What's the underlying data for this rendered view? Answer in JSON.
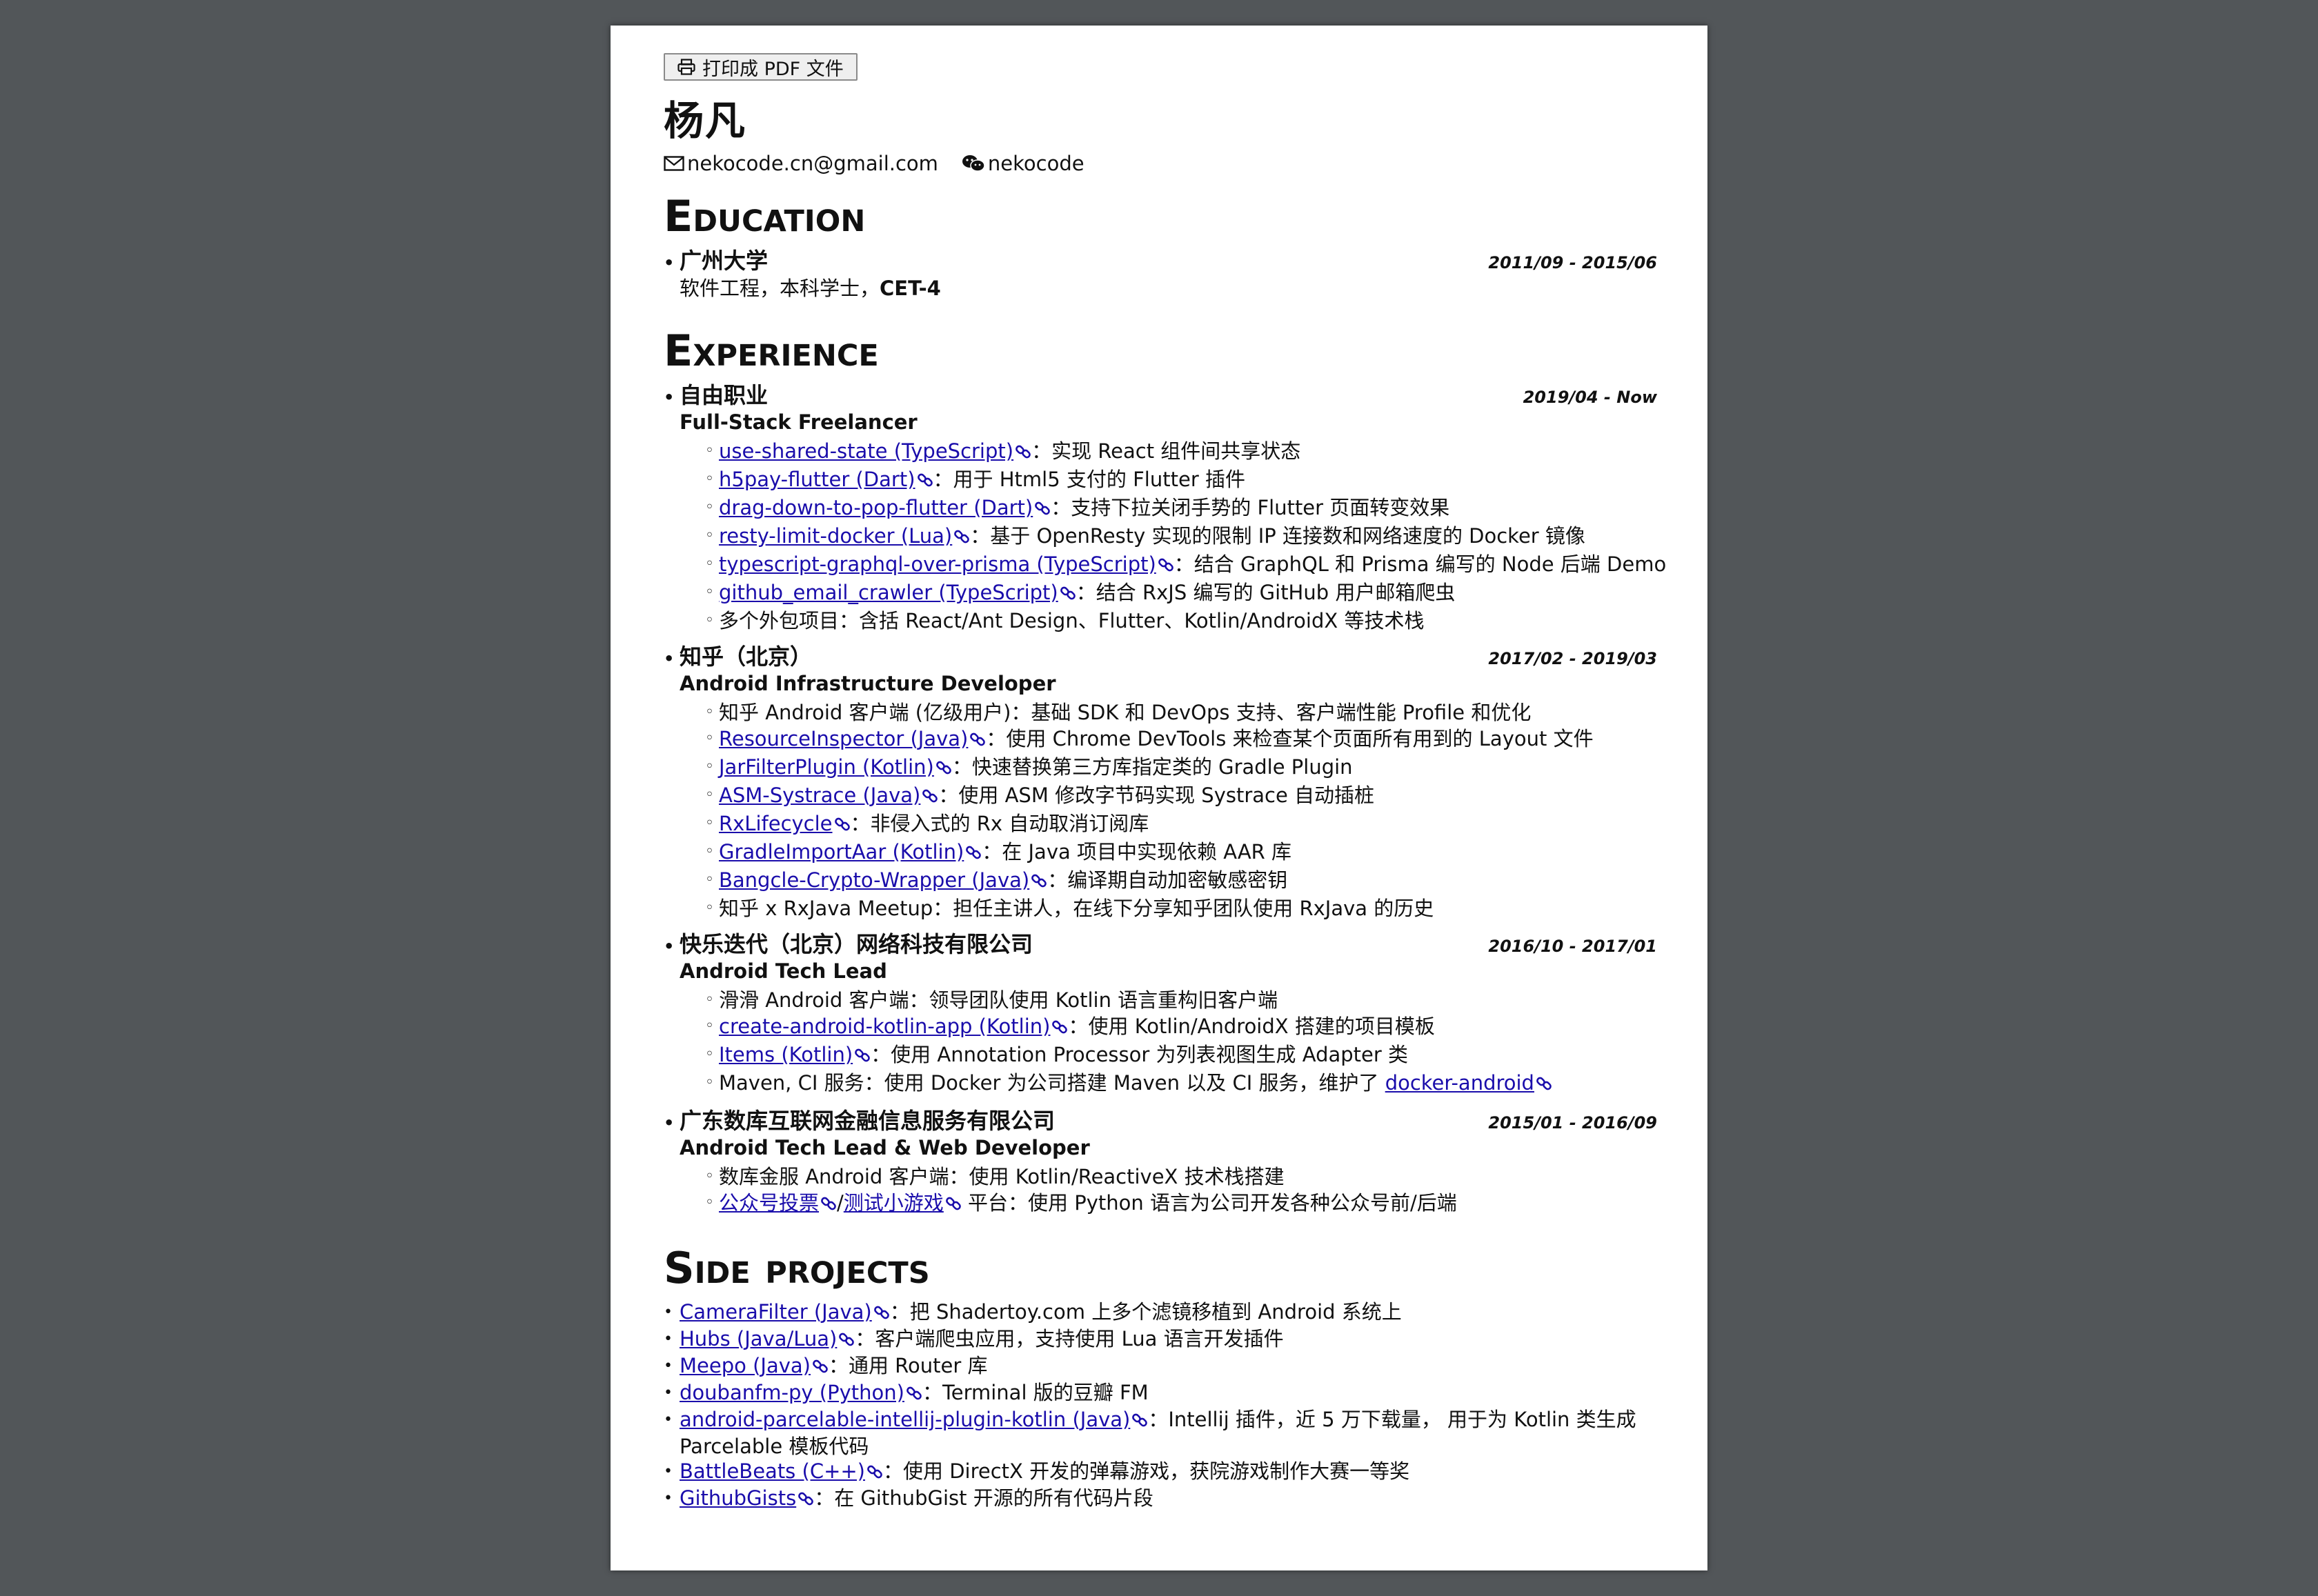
{
  "print_button": {
    "label": "打印成 PDF 文件"
  },
  "name": "杨凡",
  "contacts": {
    "email": "nekocode.cn@gmail.com",
    "wechat": "nekocode"
  },
  "sections": {
    "education": "Education",
    "experience": "Experience",
    "side_projects": "Side projects"
  },
  "education": {
    "school": "广州大学",
    "date": "2011/09 - 2015/06",
    "degree": "软件工程，本科学士，",
    "cert": "CET-4"
  },
  "experience": [
    {
      "org": "自由职业",
      "date": "2019/04 - Now",
      "role": "Full-Stack Freelancer",
      "items": [
        {
          "link": "use-shared-state (TypeScript)",
          "text": "：实现 React 组件间共享状态"
        },
        {
          "link": "h5pay-flutter (Dart)",
          "text": "：用于 Html5 支付的 Flutter 插件"
        },
        {
          "link": "drag-down-to-pop-flutter (Dart)",
          "text": "：支持下拉关闭手势的 Flutter 页面转变效果"
        },
        {
          "link": "resty-limit-docker (Lua)",
          "text": "：基于 OpenResty 实现的限制 IP 连接数和网络速度的 Docker 镜像"
        },
        {
          "link": "typescript-graphql-over-prisma (TypeScript)",
          "text": "：结合 GraphQL 和 Prisma 编写的 Node 后端 Demo"
        },
        {
          "link": "github_email_crawler (TypeScript)",
          "text": "：结合 RxJS 编写的 GitHub 用户邮箱爬虫"
        },
        {
          "link": "",
          "text": "多个外包项目：含括 React/Ant Design、Flutter、Kotlin/AndroidX 等技术栈"
        }
      ]
    },
    {
      "org": "知乎（北京）",
      "date": "2017/02 - 2019/03",
      "role": "Android Infrastructure Developer",
      "items": [
        {
          "link": "",
          "text": "知乎 Android 客户端 (亿级用户)：基础 SDK 和 DevOps 支持、客户端性能 Profile 和优化"
        },
        {
          "link": "ResourceInspector (Java)",
          "text": "：使用 Chrome DevTools 来检查某个页面所有用到的 Layout 文件"
        },
        {
          "link": "JarFilterPlugin (Kotlin)",
          "text": "：快速替换第三方库指定类的 Gradle Plugin"
        },
        {
          "link": "ASM-Systrace (Java)",
          "text": "：使用 ASM 修改字节码实现 Systrace 自动插桩"
        },
        {
          "link": "RxLifecycle",
          "text": "：非侵入式的 Rx 自动取消订阅库"
        },
        {
          "link": "GradleImportAar (Kotlin)",
          "text": "：在 Java 项目中实现依赖 AAR 库"
        },
        {
          "link": "Bangcle-Crypto-Wrapper (Java)",
          "text": "：编译期自动加密敏感密钥"
        },
        {
          "link": "",
          "text": "知乎 x RxJava Meetup：担任主讲人，在线下分享知乎团队使用 RxJava 的历史"
        }
      ]
    },
    {
      "org": "快乐迭代（北京）网络科技有限公司",
      "date": "2016/10 - 2017/01",
      "role": "Android Tech Lead",
      "items": [
        {
          "link": "",
          "text": "滑滑 Android 客户端：领导团队使用 Kotlin 语言重构旧客户端"
        },
        {
          "link": "create-android-kotlin-app (Kotlin)",
          "text": "：使用 Kotlin/AndroidX 搭建的项目模板"
        },
        {
          "link": "Items (Kotlin)",
          "text": "：使用 Annotation Processor 为列表视图生成 Adapter 类"
        },
        {
          "link": "",
          "text": "Maven, CI 服务：使用 Docker 为公司搭建 Maven 以及 CI 服务，维护了 ",
          "tail_link": "docker-android"
        }
      ]
    },
    {
      "org": "广东数库互联网金融信息服务有限公司",
      "date": "2015/01 - 2016/09",
      "role": "Android Tech Lead & Web Developer",
      "items": [
        {
          "link": "",
          "text": "数库金服 Android 客户端：使用 Kotlin/ReactiveX 技术栈搭建"
        },
        {
          "link": "公众号投票",
          "sep": "/",
          "link2": "测试小游戏",
          "text": "平台：使用 Python 语言为公司开发各种公众号前/后端"
        }
      ]
    }
  ],
  "side_projects": [
    {
      "link": "CameraFilter (Java)",
      "text": "：把 Shadertoy.com 上多个滤镜移植到 Android 系统上"
    },
    {
      "link": "Hubs (Java/Lua)",
      "text": "：客户端爬虫应用，支持使用 Lua 语言开发插件"
    },
    {
      "link": "Meepo (Java)",
      "text": "：通用 Router 库"
    },
    {
      "link": "doubanfm-py (Python)",
      "text": "：Terminal 版的豆瓣 FM"
    },
    {
      "link": "android-parcelable-intellij-plugin-kotlin (Java)",
      "text": "：Intellij 插件，近 5 万下载量， 用于为 Kotlin 类生成 Parcelable 模板代码"
    },
    {
      "link": "BattleBeats (C++)",
      "text": "：使用 DirectX 开发的弹幕游戏，获院游戏制作大赛一等奖"
    },
    {
      "link": "GithubGists",
      "text": "：在 GithubGist 开源的所有代码片段"
    }
  ],
  "icons": {
    "print": "printer-icon",
    "email": "envelope-icon",
    "wechat": "wechat-icon",
    "link": "chain-link-icon"
  },
  "colors": {
    "link": "#1a0dab",
    "background": "#525659",
    "page": "#ffffff"
  }
}
